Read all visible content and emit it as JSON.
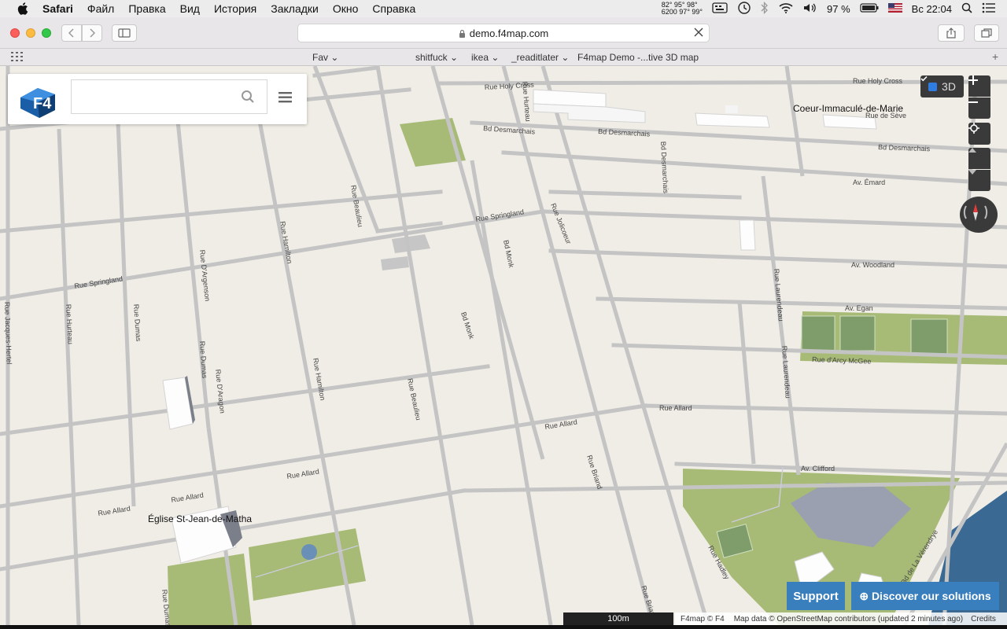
{
  "menubar": {
    "app": "Safari",
    "items": [
      "Файл",
      "Правка",
      "Вид",
      "История",
      "Закладки",
      "Окно",
      "Справка"
    ],
    "temps_top": "82°  95°  98°",
    "temps_bottom": "6200  97°  99°",
    "battery": "97 %",
    "clock": "Вс 22:04"
  },
  "toolbar": {
    "url": "demo.f4map.com"
  },
  "bookmarks": {
    "items": [
      "Fav",
      "shitfuck",
      "ikea",
      "_readitlater",
      "F4map Demo -...tive 3D map"
    ]
  },
  "map": {
    "search_placeholder": "",
    "toggle_3d": "3D",
    "roads": {
      "r1": "Rue Springland",
      "r2": "Rue Springland",
      "r3": "Rue Allard",
      "r4": "Rue Allard",
      "r5": "Rue Allard",
      "r6": "Rue Allard",
      "r7": "Rue Allard",
      "r8": "Bd Desmarchais",
      "r9": "Bd Desmarchais",
      "r10": "Rue Holy Cross",
      "r11": "Av. Émard",
      "r12": "Av. Woodland",
      "r13": "Av. Egan",
      "r14": "Rue d'Arcy McGee",
      "r15": "Av. Clifford",
      "r16": "Rue Hamilton",
      "r17": "Rue Hamilton",
      "r18": "Rue Beaulieu",
      "r19": "Rue Beaulieu",
      "r20": "Bd Monk",
      "r21": "Bd Monk",
      "r22": "Rue Briand",
      "r23": "Rue Briand",
      "r24": "Rue Hadley",
      "r25": "Rue D'Argenson",
      "r26": "Rue D'Aragon",
      "r27": "Rue Dumas",
      "r28": "Rue Hurteau",
      "r29": "Rue Jacques-Hertel",
      "r30": "Bd Desmarchais",
      "r31": "Rue Holy Cross",
      "r32": "Rue de Sève",
      "r33": "Bd Desmarchais",
      "r34": "Rue Jolicoeur",
      "r35": "Rue Laurendeau",
      "r36": "Rue Laurendeau",
      "r37": "Rue Dumas",
      "r38": "Rue Hurteau",
      "r39": "Bd de La Vérendrye",
      "r40": "Rue Dumas"
    },
    "pois": {
      "church": "Église St-Jean-de-Matha",
      "coeur": "Coeur-Immaculé-de-Marie"
    },
    "support_label": "Support",
    "discover_label": "⊕ Discover our solutions",
    "scale": "100m",
    "attribution": {
      "a1": "F4map © F4",
      "a2": "Map data © OpenStreetMap contributors (updated 2 minutes ago)",
      "a3": "Credits"
    }
  }
}
